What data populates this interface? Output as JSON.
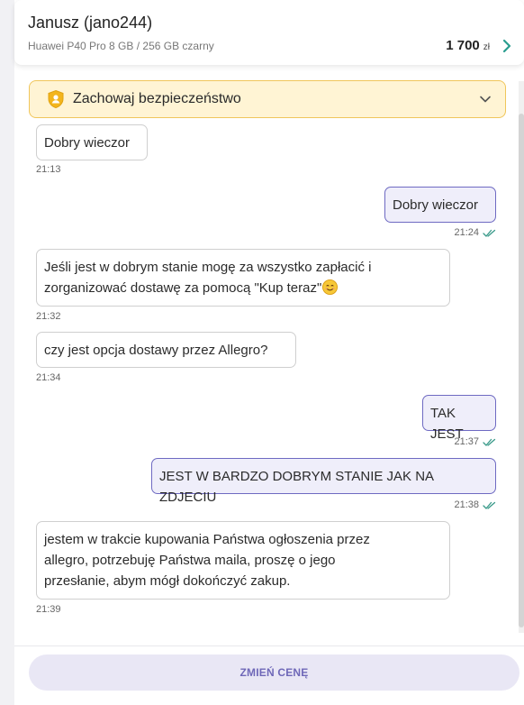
{
  "header": {
    "name": "Janusz (jano244)",
    "product": "Huawei P40 Pro 8 GB / 256 GB czarny",
    "price": "1 700",
    "currency": "zł"
  },
  "safety_banner": {
    "label": "Zachowaj bezpieczeństwo"
  },
  "messages": [
    {
      "direction": "in",
      "text": "Dobry wieczor",
      "time": "21:13"
    },
    {
      "direction": "out",
      "text": "Dobry wieczor",
      "time": "21:24",
      "read": true
    },
    {
      "direction": "in",
      "lines": [
        "Jeśli jest w dobrym stanie mogę za wszystko zapłacić i",
        "zorganizować dostawę za pomocą \"Kup teraz\""
      ],
      "emoji": "smiling-face",
      "time": "21:32"
    },
    {
      "direction": "in",
      "text": "czy jest opcja dostawy przez Allegro?",
      "time": "21:34"
    },
    {
      "direction": "out",
      "text": "TAK JEST",
      "time": "21:37",
      "read": true
    },
    {
      "direction": "out",
      "text": "JEST W BARDZO DOBRYM STANIE JAK NA ZDJECIU",
      "time": "21:38",
      "read": true
    },
    {
      "direction": "in",
      "lines": [
        "jestem w trakcie kupowania Państwa ogłoszenia przez",
        "allegro, potrzebuję Państwa maila, proszę o jego",
        "przesłanie, abym mógł dokończyć zakup."
      ],
      "time": "21:39"
    }
  ],
  "footer": {
    "button_label": "ZMIEŃ CENĘ"
  },
  "colors": {
    "accent": "#6e6ac2",
    "outgoing_bubble": "#efeefa",
    "safety_bg": "#fff4d4",
    "safety_border": "#f0c65b",
    "read_tick": "#3a9a8a"
  }
}
